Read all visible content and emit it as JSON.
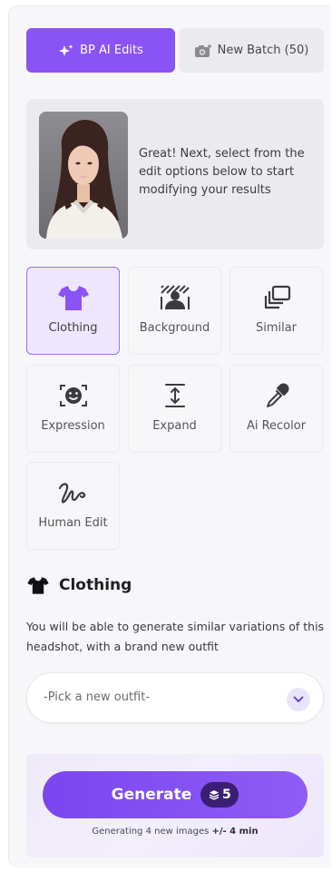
{
  "tabs": {
    "active_label": "BP AI Edits",
    "batch_label": "New Batch (50)"
  },
  "info_card": {
    "message": "Great! Next, select from the edit options below to start modifying your results"
  },
  "options": [
    {
      "label": "Clothing",
      "icon": "shirt-icon",
      "selected": true
    },
    {
      "label": "Background",
      "icon": "background-icon",
      "selected": false
    },
    {
      "label": "Similar",
      "icon": "similar-icon",
      "selected": false
    },
    {
      "label": "Expression",
      "icon": "expression-icon",
      "selected": false
    },
    {
      "label": "Expand",
      "icon": "expand-icon",
      "selected": false
    },
    {
      "label": "Ai Recolor",
      "icon": "eyedropper-icon",
      "selected": false
    },
    {
      "label": "Human Edit",
      "icon": "signature-icon",
      "selected": false
    }
  ],
  "section": {
    "title": "Clothing",
    "description": "You will be able to generate similar variations of this headshot, with a brand new outfit"
  },
  "outfit_select": {
    "value": "-Pick a new outfit-"
  },
  "generate": {
    "label": "Generate",
    "credits": "5",
    "note_prefix": "Generating 4 new images ",
    "note_time": "+/- 4 min"
  },
  "colors": {
    "accent": "#8a53f5",
    "selected_bg": "#eee6ff",
    "credit_badge": "#3a1f72"
  }
}
